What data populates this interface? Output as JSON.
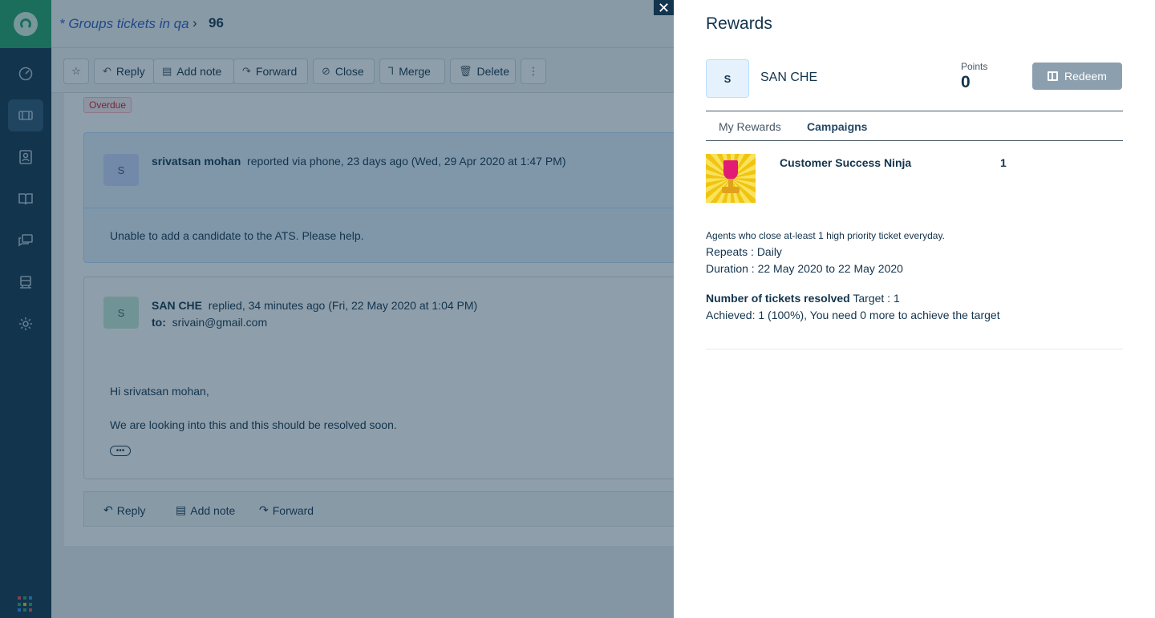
{
  "breadcrumb": {
    "view": "* Groups tickets in qa",
    "separator": "›",
    "ticket_id": "96"
  },
  "toolbar": {
    "star_label": "",
    "reply": "Reply",
    "add_note": "Add note",
    "forward": "Forward",
    "close": "Close",
    "merge": "Merge",
    "delete": "Delete"
  },
  "status_badge": "Overdue",
  "conversation1": {
    "avatar": "S",
    "author": "srivatsan mohan",
    "meta": "reported via phone, 23 days ago (Wed, 29 Apr 2020 at 1:47 PM)",
    "body": "Unable to add a candidate to the ATS. Please help."
  },
  "conversation2": {
    "avatar": "S",
    "author": "SAN CHE",
    "meta": "replied, 34 minutes ago (Fri, 22 May 2020 at 1:04 PM)",
    "to_label": "to:",
    "to_value": "srivain@gmail.com",
    "greeting": "Hi srivatsan mohan,",
    "body": "We are looking into this and this should be resolved soon.",
    "more": "•••"
  },
  "bottombar": {
    "reply": "Reply",
    "add_note": "Add note",
    "forward": "Forward"
  },
  "panel": {
    "close": "✕",
    "title": "Rewards",
    "avatar": "S",
    "name": "SAN CHE",
    "points_label": "Points",
    "points_value": "0",
    "redeem": "Redeem",
    "tabs": [
      "My Rewards",
      "Campaigns"
    ],
    "active_tab": "Campaigns",
    "campaign": {
      "name": "Customer Success Ninja",
      "count": "1",
      "description": "Agents who close at-least 1 high priority ticket everyday.",
      "repeats": "Repeats : Daily",
      "duration": "Duration : 22 May 2020 to 22 May 2020",
      "metric_label": "Number of tickets resolved",
      "target": "Target : 1",
      "achieved": "Achieved: 1 (100%), You need 0 more to achieve the target"
    }
  },
  "colors": {
    "sidebar": "#12344d",
    "brand_green": "#23a46a",
    "link_blue": "#2c5cc5",
    "overdue_red": "#c82124",
    "redeem_disabled": "#8c9fae"
  },
  "icons": [
    "headset-logo-icon",
    "dashboard-icon",
    "tickets-icon",
    "contacts-icon",
    "solutions-icon",
    "forums-icon",
    "admin-icon",
    "settings-icon",
    "apps-grid-icon"
  ]
}
